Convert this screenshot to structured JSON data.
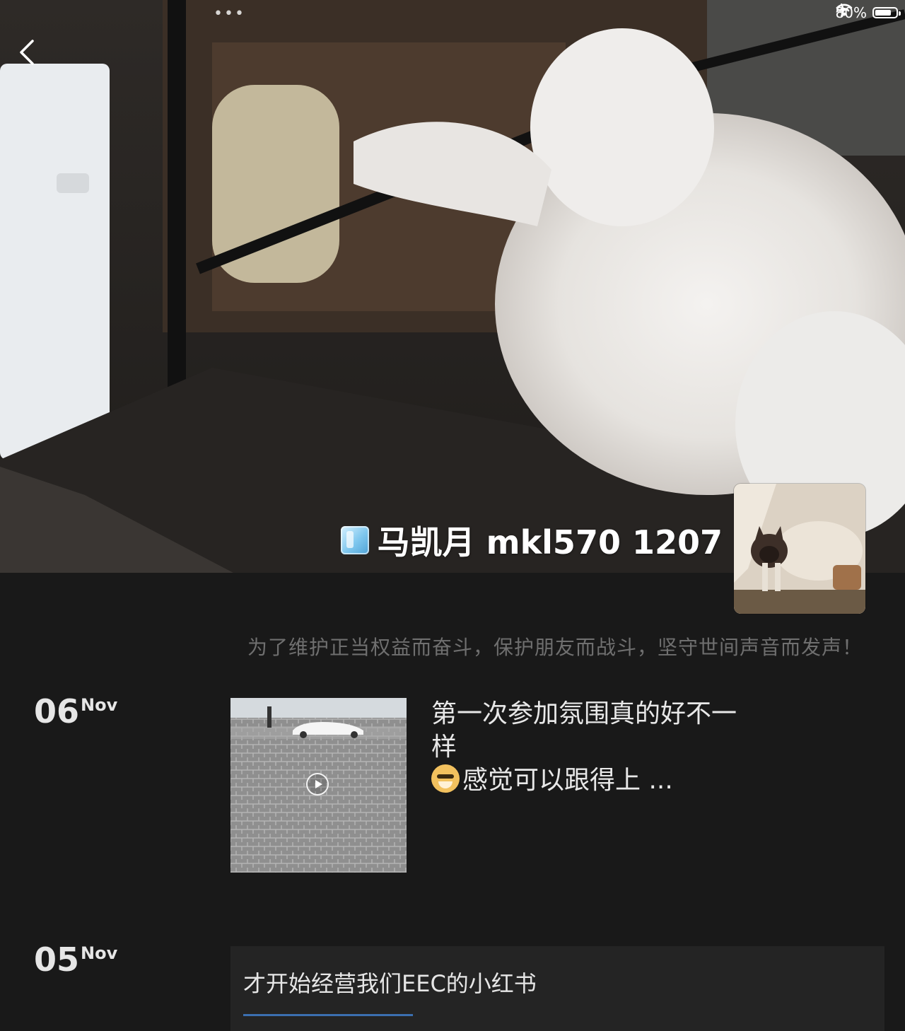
{
  "status_bar": {
    "battery": "80%",
    "battery_level": 0.8,
    "icons": [
      "airplane-icon",
      "wifi-icon",
      "battery-icon"
    ]
  },
  "header": {
    "back_icon": "chevron-left-icon",
    "handle_dots": "•••"
  },
  "profile": {
    "name": "马凯月 mkl570 1207",
    "badge_icon": "ice-cube-icon",
    "signature": "为了维护正当权益而奋斗，保护朋友而战斗，坚守世间声音而发声！"
  },
  "posts": [
    {
      "day": "06",
      "month": "Nov",
      "type": "video",
      "text_line1": "第一次参加氛围真的好不一",
      "text_line2": "样",
      "text_line3": "感觉可以跟得上 ..."
    },
    {
      "day": "05",
      "month": "Nov",
      "type": "text",
      "text": "才开始经营我们EEC的小红书"
    }
  ]
}
